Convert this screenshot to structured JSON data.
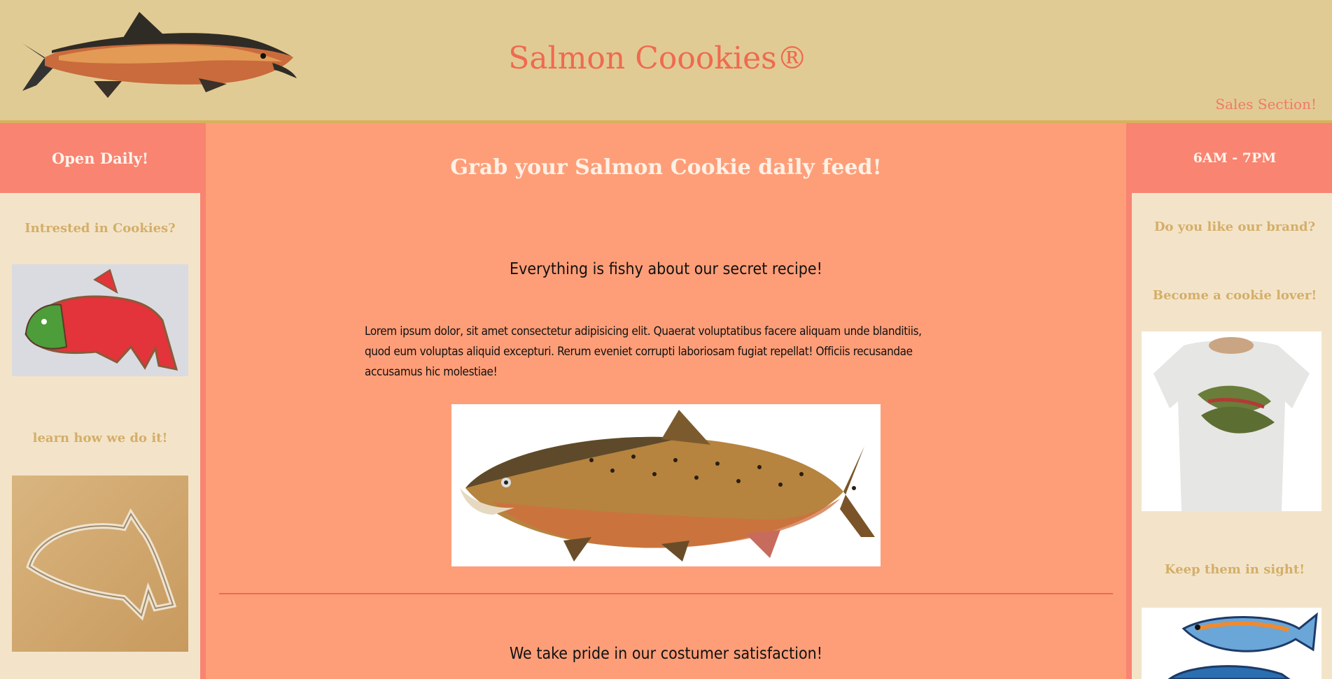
{
  "header": {
    "title": "Salmon Coookies®",
    "sales_link": "Sales Section!"
  },
  "left_sidebar": {
    "band": "Open Daily!",
    "question": "Intrested in Cookies?",
    "learn": "learn how we do it!"
  },
  "main": {
    "heading": "Grab your Salmon Cookie daily feed!",
    "tagline": "Everything is fishy about our secret recipe!",
    "paragraph": "Lorem ipsum dolor, sit amet consectetur adipisicing elit. Quaerat voluptatibus facere aliquam unde blanditiis, quod eum voluptas aliquid excepturi. Rerum eveniet corrupti laboriosam fugiat repellat! Officiis recusandae accusamus hic molestiae!",
    "satisfaction": "We take pride in our costumer satisfaction!"
  },
  "right_sidebar": {
    "band": "6AM - 7PM",
    "brand_question": "Do you like our brand?",
    "lover": "Become a cookie lover!",
    "sight": "Keep them in sight!"
  },
  "colors": {
    "header_bg": "#e1cb94",
    "main_bg": "#fe9e78",
    "accent": "#f88471",
    "title": "#ef6a4f",
    "side_text": "#d4ae69"
  }
}
